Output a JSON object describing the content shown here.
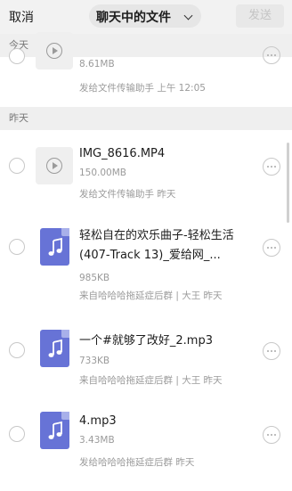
{
  "topbar": {
    "cancel_label": "取消",
    "title": "聊天中的文件",
    "send_label": "发送"
  },
  "sections": {
    "today": "今天",
    "yesterday": "昨天"
  },
  "files": [
    {
      "type": "video",
      "name": "",
      "size": "8.61MB",
      "from": "发给文件传输助手 上午 12:05"
    },
    {
      "type": "video",
      "name": "IMG_8616.MP4",
      "size": "150.00MB",
      "from": "发给文件传输助手 昨天"
    },
    {
      "type": "audio",
      "name": "轻松自在的欢乐曲子-轻松生活 (407-Track 13)_爱给网_...",
      "size": "985KB",
      "from": "来自哈哈哈拖延症后群 | 大王 昨天"
    },
    {
      "type": "audio",
      "name": "一个#就够了改好_2.mp3",
      "size": "733KB",
      "from": "来自哈哈哈拖延症后群 | 大王 昨天"
    },
    {
      "type": "audio",
      "name": "4.mp3",
      "size": "3.43MB",
      "from": "发给哈哈哈拖延症后群 昨天"
    }
  ],
  "colors": {
    "file_icon": "#6773d6",
    "send_disabled": "#c4c4c4"
  }
}
